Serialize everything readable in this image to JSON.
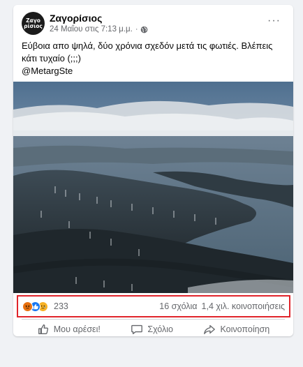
{
  "post": {
    "page_name": "Ζαγορίσιος",
    "avatar_text_line1": "Zαγο",
    "avatar_text_line2": "ρίσιος",
    "timestamp": "24 Μαΐου στις 7:13 μ.μ.",
    "separator": "·",
    "more_label": "···",
    "text_line1": "Εύβοια απο ψηλά, δύο χρόνια σχεδόν μετά τις φωτιές. Βλέπεις κάτι τυχαίο (;;;)",
    "text_line2": "@MetargSte"
  },
  "stats": {
    "reaction_count": "233",
    "comments": "16 σχόλια",
    "shares": "1,4 χιλ. κοινοποιήσεις",
    "highlight_color": "#e0242b"
  },
  "actions": {
    "like": "Μου αρέσει!",
    "comment": "Σχόλιο",
    "share": "Κοινοποίηση"
  },
  "icons": {
    "reactions": [
      "angry-reaction-icon",
      "like-reaction-icon",
      "sad-reaction-icon"
    ],
    "privacy": "globe-icon"
  }
}
